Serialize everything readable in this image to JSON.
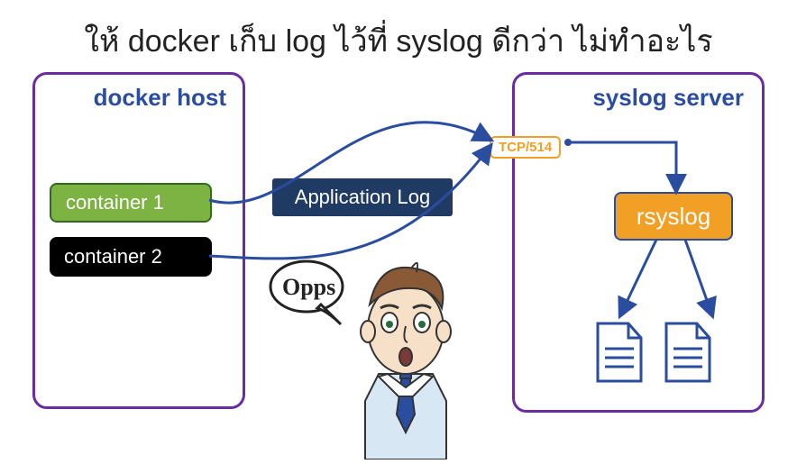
{
  "title": "ให้ docker เก็บ log ไว้ที่ syslog ดีกว่า ไม่ทำอะไร",
  "dockerHost": {
    "label": "docker host",
    "containers": [
      {
        "label": "container 1"
      },
      {
        "label": "container 2"
      }
    ]
  },
  "applicationLog": {
    "label": "Application Log"
  },
  "syslogServer": {
    "label": "syslog server",
    "port": "TCP/514",
    "service": "rsyslog"
  },
  "speech": {
    "text": "Opps"
  },
  "colors": {
    "boxBorder": "#6a2ca0",
    "accentBlue": "#2a4da0",
    "orange": "#f29f26",
    "container1": "#7cb342",
    "container2": "#000000",
    "appLogBg": "#1f3a63"
  }
}
